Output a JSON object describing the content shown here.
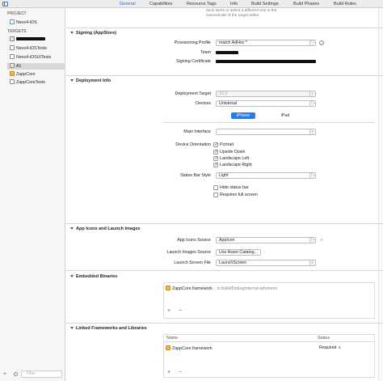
{
  "tabs": [
    "General",
    "Capabilities",
    "Resource Tags",
    "Info",
    "Build Settings",
    "Build Phases",
    "Build Rules"
  ],
  "active_tab": "General",
  "sidebar": {
    "project_header": "PROJECT",
    "project_item": "Nexx4-iOS",
    "targets_header": "TARGETS",
    "targets": [
      "Nexx4-iOSTests",
      "Nexx4-iOSUITests",
      "A1",
      "ZappCore",
      "ZappCoreTests"
    ],
    "filter_placeholder": "Filter"
  },
  "hint_text": "dock items or select a different one in the General tab of the target editor.",
  "signing": {
    "title": "Signing (AppStore)",
    "provisioning_label": "Provisioning Profile",
    "provisioning_value": "match AdHoc *",
    "team_label": "Team",
    "certificate_label": "Signing Certificate"
  },
  "deployment": {
    "title": "Deployment Info",
    "target_label": "Deployment Target",
    "target_value": "10.3",
    "devices_label": "Devices",
    "devices_value": "Universal",
    "seg_iphone": "iPhone",
    "seg_ipad": "iPad",
    "main_interface_label": "Main Interface",
    "orientation_label": "Device Orientation",
    "orientations": [
      "Portrait",
      "Upside Down",
      "Landscape Left",
      "Landscape Right"
    ],
    "status_bar_label": "Status Bar Style",
    "status_bar_value": "Light",
    "hide_status_bar": "Hide status bar",
    "requires_full_screen": "Requires full screen"
  },
  "app_icons": {
    "title": "App Icons and Launch Images",
    "icons_source_label": "App Icons Source",
    "icons_source_value": "AppIcon",
    "launch_images_label": "Launch Images Source",
    "launch_images_value": "Use Asset Catalog...",
    "launch_screen_label": "Launch Screen File",
    "launch_screen_value": "LaunchScreen"
  },
  "embedded": {
    "title": "Embedded Binaries",
    "item_name": "ZappCore.framework",
    "item_path": "...in build/Debuginternal-iphoneos",
    "add_remove": "+ −"
  },
  "linked": {
    "title": "Linked Frameworks and Libraries",
    "col_name": "Name",
    "col_status": "Status",
    "item_name": "ZappCore.framework",
    "item_status": "Required",
    "add_remove": "+ −"
  },
  "colors": {
    "accent": "#2b7be5",
    "framework_icon": "#f4b93a",
    "redaction": "#111111"
  }
}
